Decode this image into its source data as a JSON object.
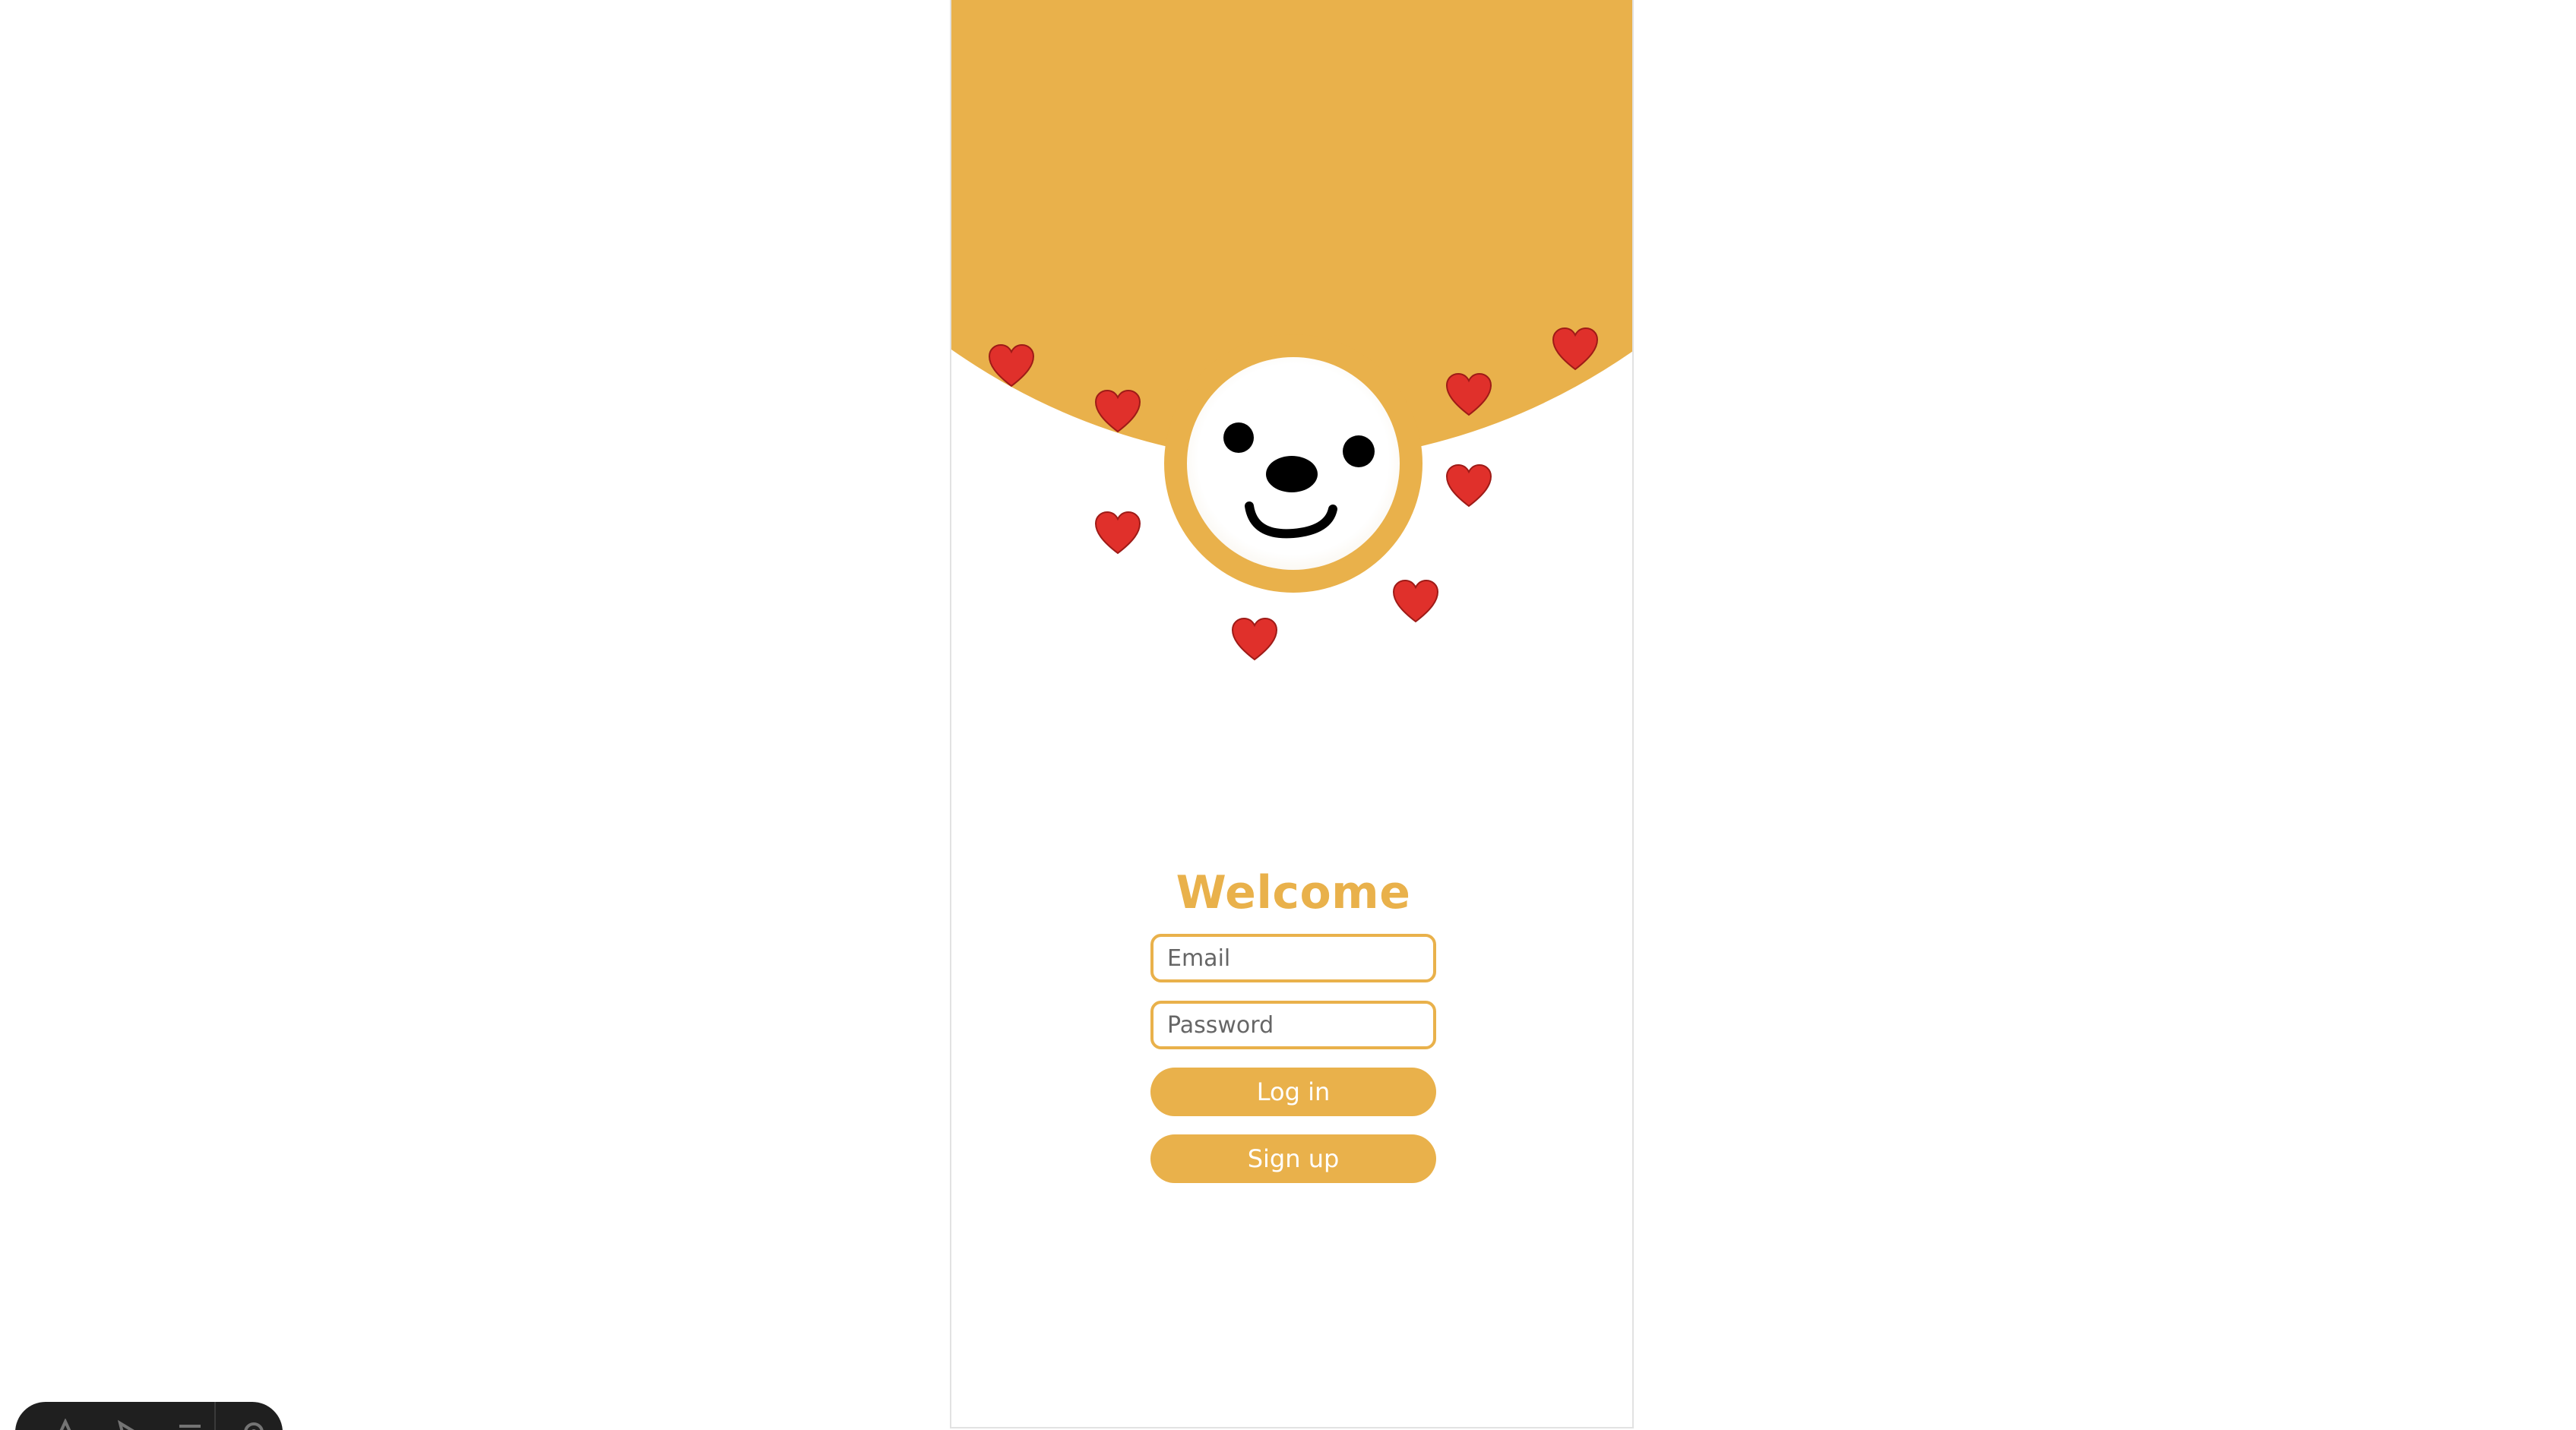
{
  "colors": {
    "accent": "#e9b14b",
    "background": "#ffffff",
    "heart": "#e0302b",
    "face_features": "#000000"
  },
  "header": {
    "mascot_icon": "smiling-face",
    "decoration_icon": "heart"
  },
  "login_form": {
    "title": "Welcome",
    "email_placeholder": "Email",
    "email_value": "",
    "password_placeholder": "Password",
    "password_value": "",
    "login_label": "Log in",
    "signup_label": "Sign up"
  },
  "dev_toolbar": {
    "icons": [
      "app-icon",
      "pointer-icon",
      "menu-icon",
      "settings-icon"
    ]
  }
}
